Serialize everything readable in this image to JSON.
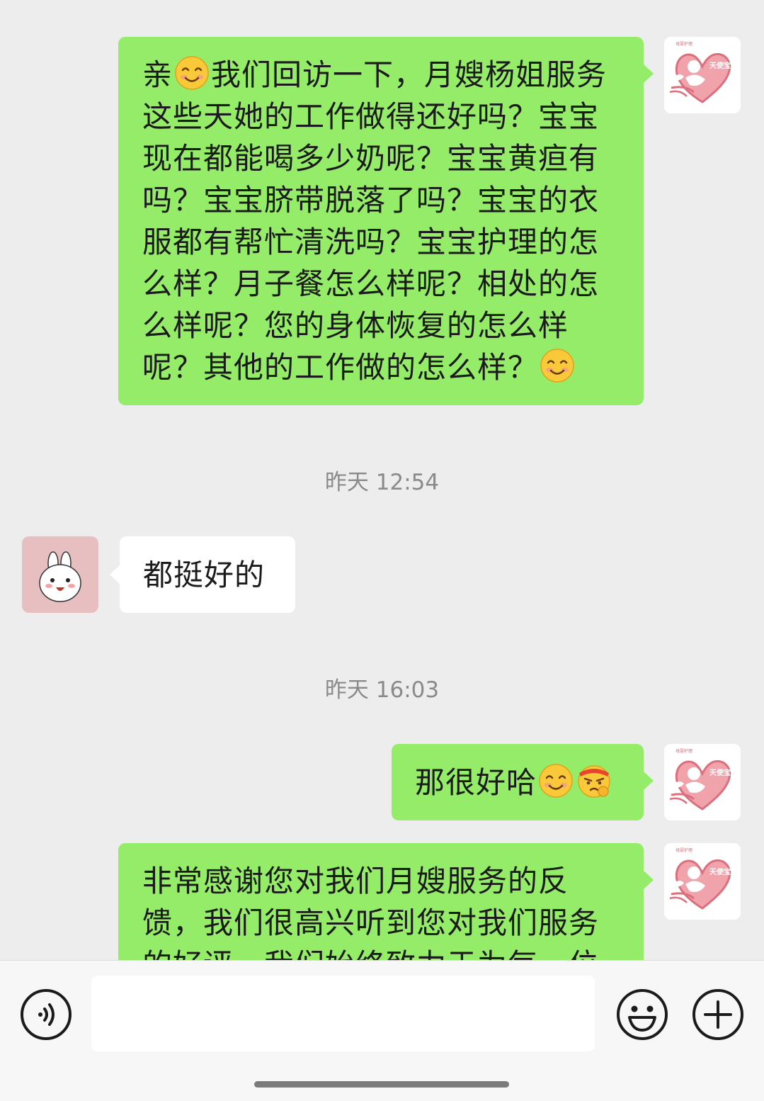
{
  "messages": [
    {
      "sender": "shop",
      "parts": [
        "亲",
        "[smile-emoji]",
        "我们回访一下，月嫂杨姐服务这些天她的工作做得还好吗？宝宝现在都能喝多少奶呢？宝宝黄疸有吗？宝宝脐带脱落了吗？宝宝的衣服都有帮忙清洗吗？宝宝护理的怎么样？月子餐怎么样呢？相处的怎么样呢？您的身体恢复的怎么样呢？其他的工作做的怎么样？",
        "[smile-emoji]"
      ]
    },
    {
      "timestamp": "昨天 12:54"
    },
    {
      "sender": "customer",
      "text": "都挺好的"
    },
    {
      "timestamp": "昨天 16:03"
    },
    {
      "sender": "shop",
      "text": "那很好哈",
      "emojis": [
        "smile-emoji",
        "determined-emoji"
      ]
    },
    {
      "sender": "shop",
      "text": "非常感谢您对我们月嫂服务的反馈，我们很高兴听到您对我们服务的好评，我们始终致力于为每一位"
    }
  ],
  "ui": {
    "msg1_line1a": "亲",
    "msg1_line1b": "我们回访一下，月嫂杨姐服务",
    "msg1_line2": "这些天她的工作做得还好吗？宝宝",
    "msg1_line3": "现在都能喝多少奶呢？宝宝黄疸有",
    "msg1_line4": "吗？宝宝脐带脱落了吗？宝宝的衣",
    "msg1_line5": "服都有帮忙清洗吗？宝宝护理的怎",
    "msg1_line6": "么样？月子餐怎么样呢？相处的怎",
    "msg1_line7": "么样呢？您的身体恢复的怎么样",
    "msg1_line8": "呢？其他的工作做的怎么样？",
    "timestamp1": "昨天 12:54",
    "msg2": "都挺好的",
    "timestamp2": "昨天 16:03",
    "msg3": "那很好哈",
    "msg4_line1": "非常感谢您对我们月嫂服务的反",
    "msg4_line2": "馈，我们很高兴听到您对我们服务",
    "msg4_line3": "的好评，我们始终致力于为每一位",
    "brand_small": "母婴护理",
    "brand_logo": "天使宝贝"
  },
  "colors": {
    "outgoing_bubble": "#95ec69",
    "incoming_bubble": "#ffffff",
    "background": "#ededed",
    "brand_heart": "#e88a94",
    "timestamp": "#8a8a8a"
  },
  "icons": [
    "voice-icon",
    "emoji-icon",
    "plus-icon",
    "smile-emoji",
    "determined-emoji",
    "bunny-avatar",
    "angel-heart-logo"
  ]
}
